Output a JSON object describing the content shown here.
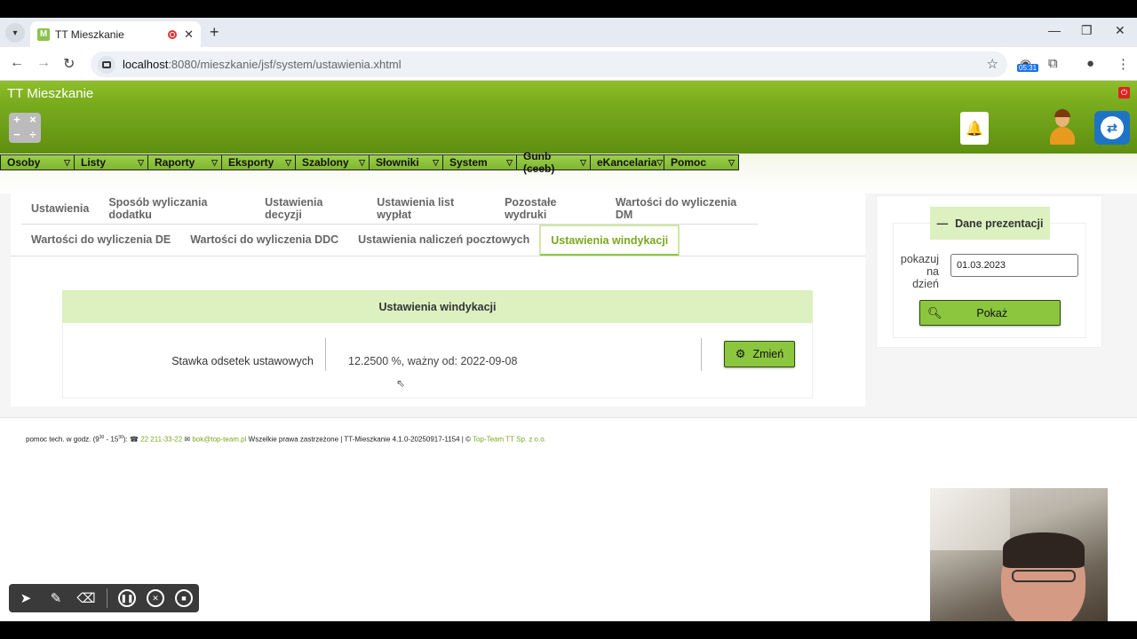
{
  "browser": {
    "tab_title": "TT Mieszkanie",
    "url_host": "localhost",
    "url_path": ":8080/mieszkanie/jsf/system/ustawienia.xhtml",
    "ext_badge": "05:31"
  },
  "app": {
    "title": "TT Mieszkanie",
    "accent_color": "#8cc63f",
    "header_color": "#7aac1e"
  },
  "menu": {
    "items": [
      {
        "label": "Osoby"
      },
      {
        "label": "Listy"
      },
      {
        "label": "Raporty"
      },
      {
        "label": "Eksporty"
      },
      {
        "label": "Szablony"
      },
      {
        "label": "Słowniki"
      },
      {
        "label": "System"
      },
      {
        "label": "Gunb (ceeb)"
      },
      {
        "label": "eKancelaria"
      },
      {
        "label": "Pomoc"
      }
    ]
  },
  "tabs": {
    "row1": [
      {
        "label": "Ustawienia"
      },
      {
        "label": "Sposób wyliczania dodatku"
      },
      {
        "label": "Ustawienia decyzji"
      },
      {
        "label": "Ustawienia list wypłat"
      },
      {
        "label": "Pozostałe wydruki"
      },
      {
        "label": "Wartości do wyliczenia DM"
      }
    ],
    "row2": [
      {
        "label": "Wartości do wyliczenia DE"
      },
      {
        "label": "Wartości do wyliczenia DDC"
      },
      {
        "label": "Ustawienia naliczeń pocztowych"
      },
      {
        "label": "Ustawienia windykacji",
        "active": true
      }
    ]
  },
  "panel": {
    "title": "Ustawienia windykacji",
    "field_label": "Stawka odsetek ustawowych",
    "field_value": "12.2500 %, ważny od: 2022-09-08",
    "button_label": "Zmień"
  },
  "sidebar": {
    "legend": "Dane prezentacji",
    "label_line1": "pokazuj",
    "label_line2": "na",
    "label_line3": "dzień",
    "date_value": "01.03.2023",
    "button_label": "Pokaż"
  },
  "footer": {
    "prefix": "pomoc tech. w godz. (9",
    "sup1": "30",
    "mid": " - 15",
    "sup2": "30",
    "after_hours": "):",
    "phone": "22 211-33-22",
    "email": "bok@top-team.pl",
    "rights": "Wszelkie prawa zastrzeżone | TT-Mieszkanie 4.1.0-20250917-1154 | ©",
    "company": "Top-Team TT Sp. z o.o."
  }
}
